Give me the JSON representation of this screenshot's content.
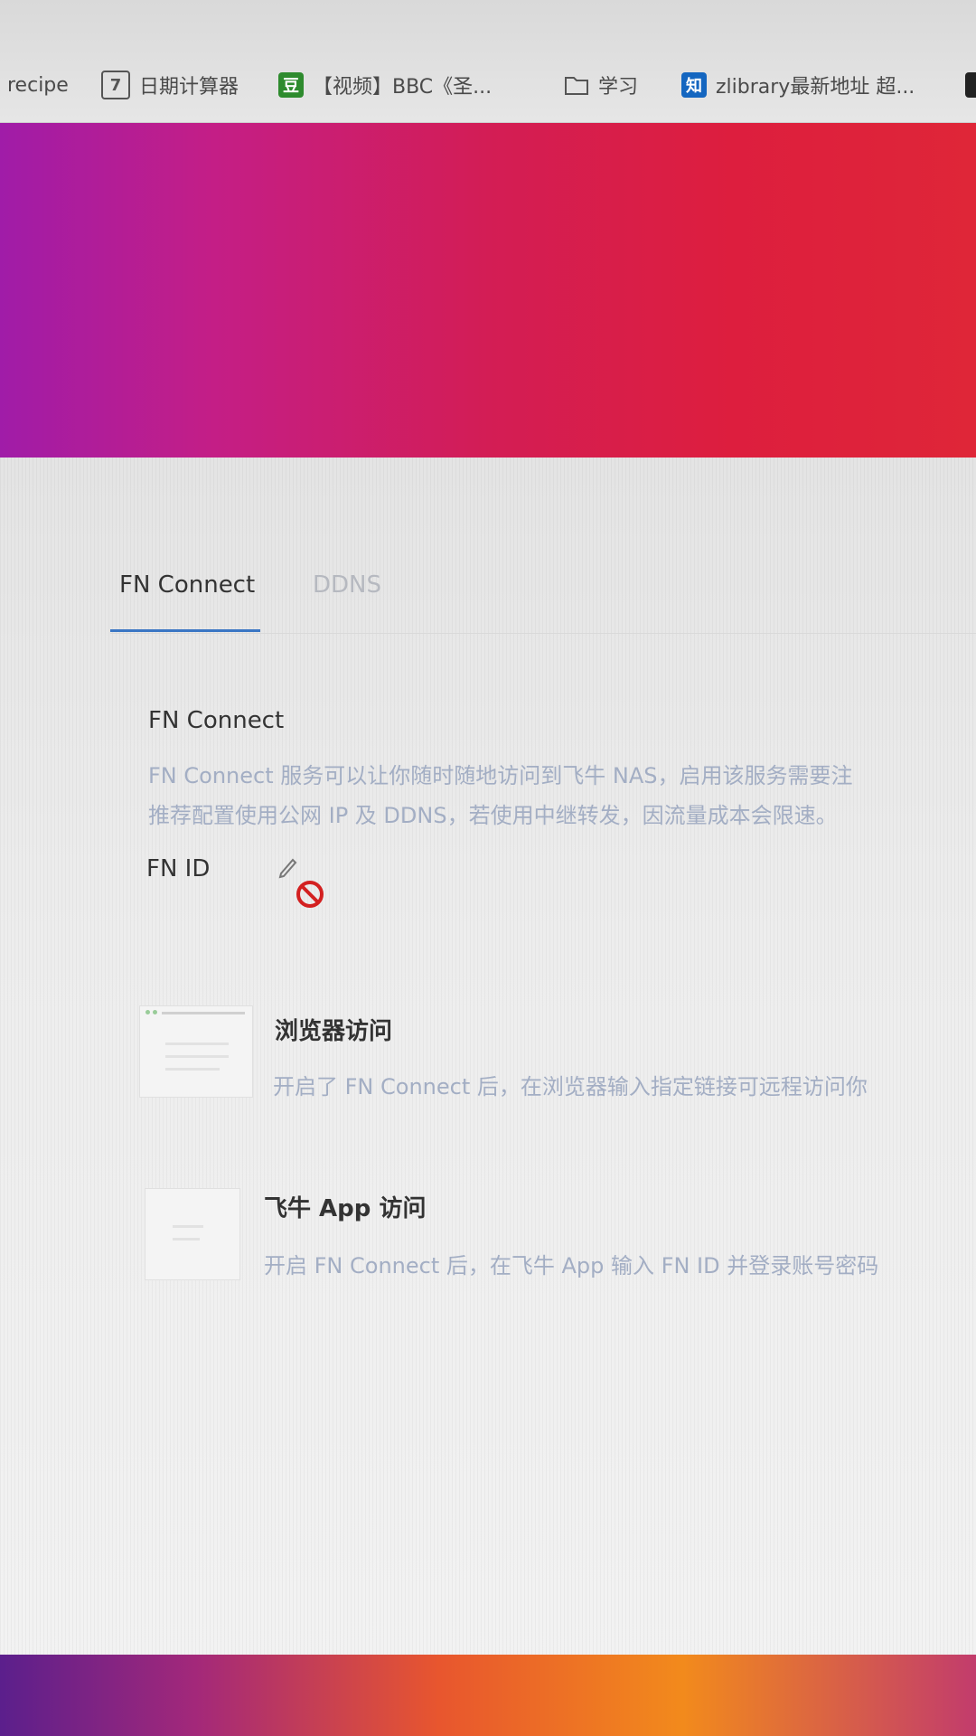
{
  "bookmarks": [
    {
      "label": "recipe",
      "icon": ""
    },
    {
      "label": "日期计算器",
      "icon": "calendar-icon",
      "glyph": "7"
    },
    {
      "label": "【视频】BBC《圣...",
      "icon": "douban-icon",
      "glyph": "豆"
    },
    {
      "label": "学习",
      "icon": "folder-icon"
    },
    {
      "label": "zlibrary最新地址 超...",
      "icon": "zhihu-icon",
      "glyph": "知"
    }
  ],
  "tabs": [
    {
      "label": "FN Connect",
      "active": true
    },
    {
      "label": "DDNS",
      "active": false
    }
  ],
  "section": {
    "title": "FN Connect",
    "desc_line1": "FN Connect 服务可以让你随时随地访问到飞牛 NAS，启用该服务需要注",
    "desc_line2": "推荐配置使用公网 IP 及 DDNS，若使用中继转发，因流量成本会限速。"
  },
  "fn_id": {
    "label": "FN ID",
    "edit_icon": "pencil-icon",
    "status_icon": "no-entry-icon"
  },
  "features": [
    {
      "title": "浏览器访问",
      "desc": "开启了 FN Connect 后，在浏览器输入指定链接可远程访问你"
    },
    {
      "title": "飞牛 App 访问",
      "desc": "开启 FN Connect 后，在飞牛 App 输入 FN ID 并登录账号密码"
    }
  ],
  "colors": {
    "accent": "#3a76c4",
    "muted_text": "#a3aec4",
    "banner_left": "#a01ca8",
    "banner_right": "#df2638",
    "deny": "#d32020"
  }
}
